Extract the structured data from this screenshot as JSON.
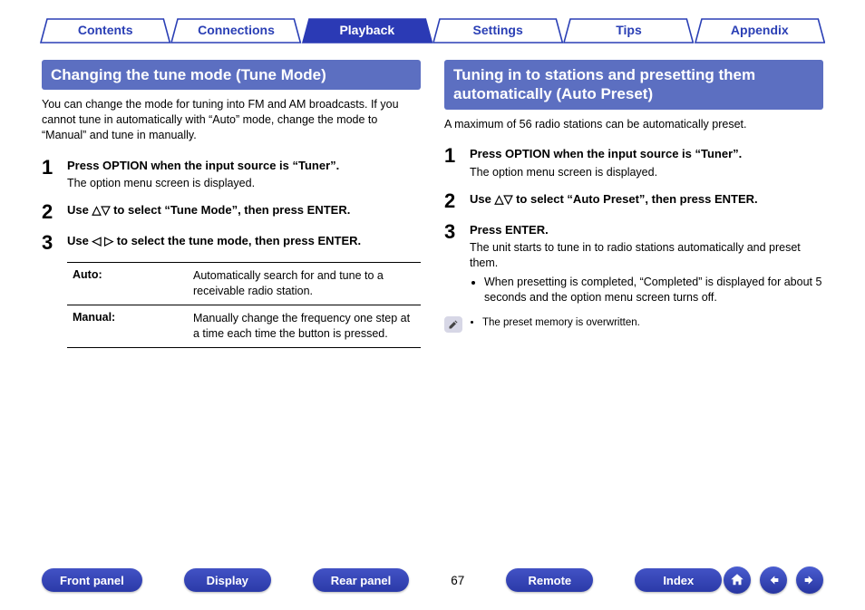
{
  "tabs": {
    "contents": "Contents",
    "connections": "Connections",
    "playback": "Playback",
    "settings": "Settings",
    "tips": "Tips",
    "appendix": "Appendix"
  },
  "left": {
    "title": "Changing the tune mode (Tune Mode)",
    "intro": "You can change the mode for tuning into FM and AM broadcasts. If you cannot tune in automatically with “Auto” mode, change the mode to “Manual” and tune in manually.",
    "step1": {
      "num": "1",
      "head": "Press OPTION when the input source is “Tuner”.",
      "desc": "The option menu screen is displayed."
    },
    "step2": {
      "num": "2",
      "head_prefix": "Use ",
      "head_suffix": " to select “Tune Mode”, then press ENTER."
    },
    "step3": {
      "num": "3",
      "head_prefix": "Use ",
      "head_suffix": " to select the tune mode, then press ENTER."
    },
    "table": {
      "auto_key": "Auto:",
      "auto_val": "Automatically search for and tune to a receivable radio station.",
      "manual_key": "Manual:",
      "manual_val": "Manually change the frequency one step at a time each time the button is pressed."
    }
  },
  "right": {
    "title": "Tuning in to stations and presetting them automatically (Auto Preset)",
    "intro": "A maximum of 56 radio stations can be automatically preset.",
    "step1": {
      "num": "1",
      "head": "Press OPTION when the input source is “Tuner”.",
      "desc": "The option menu screen is displayed."
    },
    "step2": {
      "num": "2",
      "head_prefix": "Use ",
      "head_suffix": " to select “Auto Preset”, then press ENTER."
    },
    "step3": {
      "num": "3",
      "head": "Press ENTER.",
      "desc": "The unit starts to tune in to radio stations automatically and preset them.",
      "bullet": "When presetting is completed, “Completed” is displayed for about 5 seconds and the option menu screen turns off."
    },
    "note": "The preset memory is overwritten."
  },
  "bottom": {
    "front_panel": "Front panel",
    "display": "Display",
    "rear_panel": "Rear panel",
    "page": "67",
    "remote": "Remote",
    "index": "Index"
  }
}
